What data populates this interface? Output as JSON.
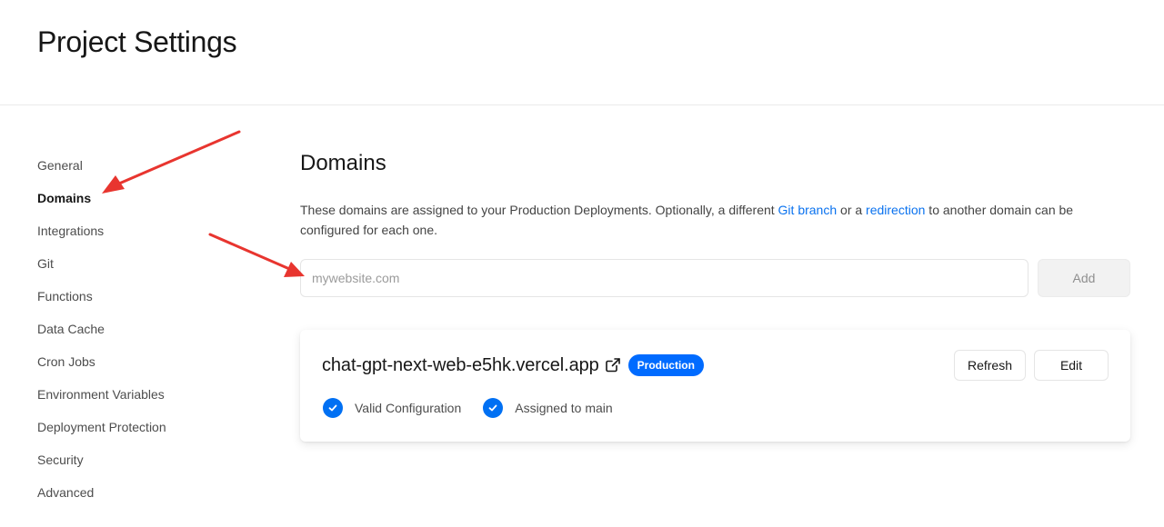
{
  "page": {
    "title": "Project Settings"
  },
  "sidebar": {
    "items": [
      {
        "label": "General"
      },
      {
        "label": "Domains"
      },
      {
        "label": "Integrations"
      },
      {
        "label": "Git"
      },
      {
        "label": "Functions"
      },
      {
        "label": "Data Cache"
      },
      {
        "label": "Cron Jobs"
      },
      {
        "label": "Environment Variables"
      },
      {
        "label": "Deployment Protection"
      },
      {
        "label": "Security"
      },
      {
        "label": "Advanced"
      }
    ],
    "active_index": 1
  },
  "domains": {
    "title": "Domains",
    "description": {
      "part1": "These domains are assigned to your Production Deployments. Optionally, a different ",
      "link1": "Git branch",
      "part2": " or a ",
      "link2": "redirection",
      "part3": " to another domain can be configured for each one."
    },
    "input": {
      "placeholder": "mywebsite.com",
      "value": ""
    },
    "add_label": "Add",
    "card": {
      "domain": "chat-gpt-next-web-e5hk.vercel.app",
      "badge": "Production",
      "refresh_label": "Refresh",
      "edit_label": "Edit",
      "statuses": [
        {
          "label": "Valid Configuration",
          "icon": "check-circle-icon"
        },
        {
          "label": "Assigned to main",
          "icon": "check-circle-icon"
        }
      ]
    }
  },
  "colors": {
    "accent": "#0070f3",
    "badge": "#006bff",
    "link": "#0a72ef",
    "annotation_arrow": "#e8352f"
  }
}
